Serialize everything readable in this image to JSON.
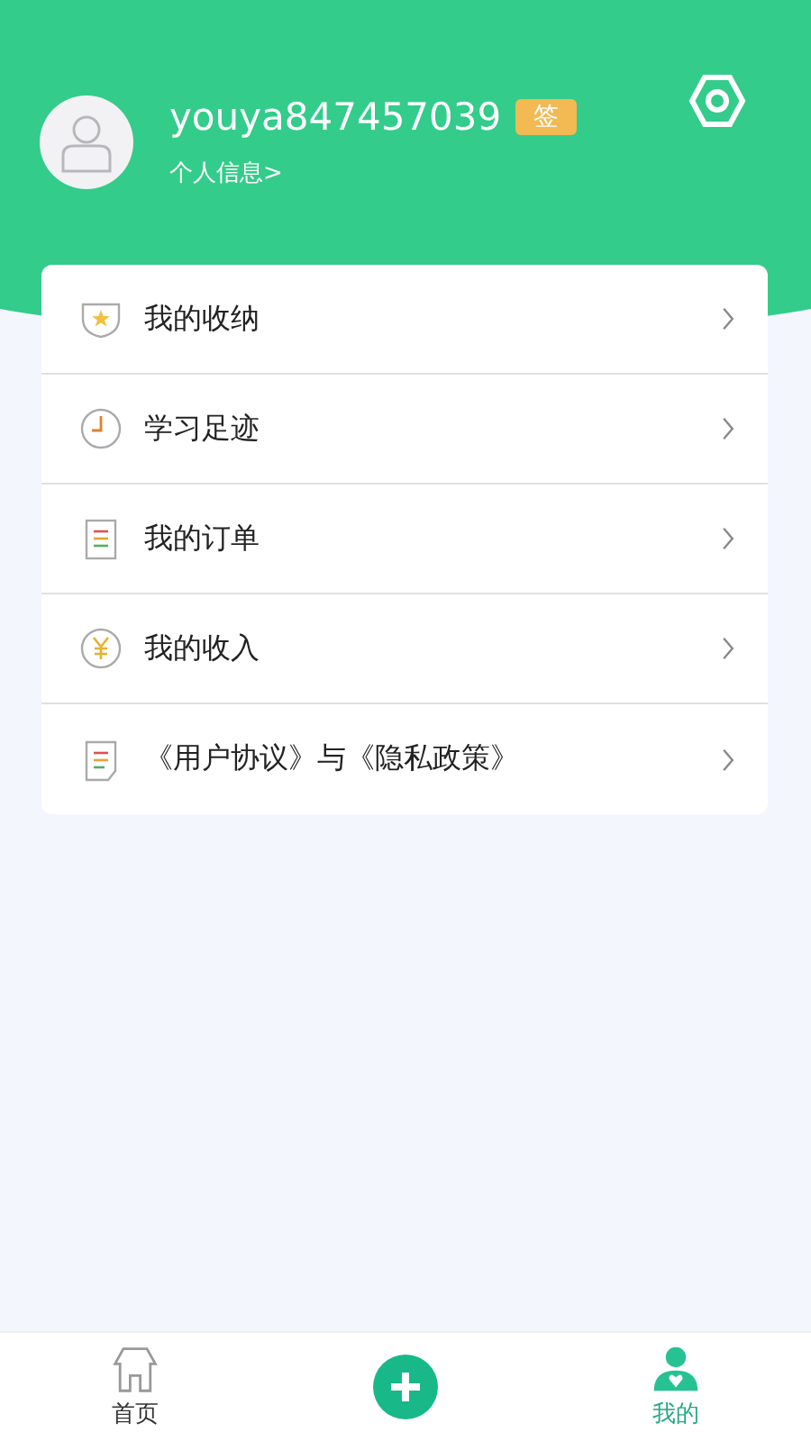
{
  "profile": {
    "username": "youya847457039",
    "sign_badge": "签",
    "info_link": "个人信息>"
  },
  "menu": [
    {
      "kind": "star",
      "label": "我的收纳"
    },
    {
      "kind": "clock",
      "label": "学习足迹"
    },
    {
      "kind": "clipboard",
      "label": "我的订单"
    },
    {
      "kind": "yuan",
      "label": "我的收入"
    },
    {
      "kind": "doc",
      "label": "《用户协议》与《隐私政策》"
    }
  ],
  "tabbar": [
    {
      "kind": "home",
      "label": "首页",
      "selected": false
    },
    {
      "kind": "add",
      "selected": false
    },
    {
      "kind": "mine",
      "label": "我的",
      "selected": true
    }
  ]
}
